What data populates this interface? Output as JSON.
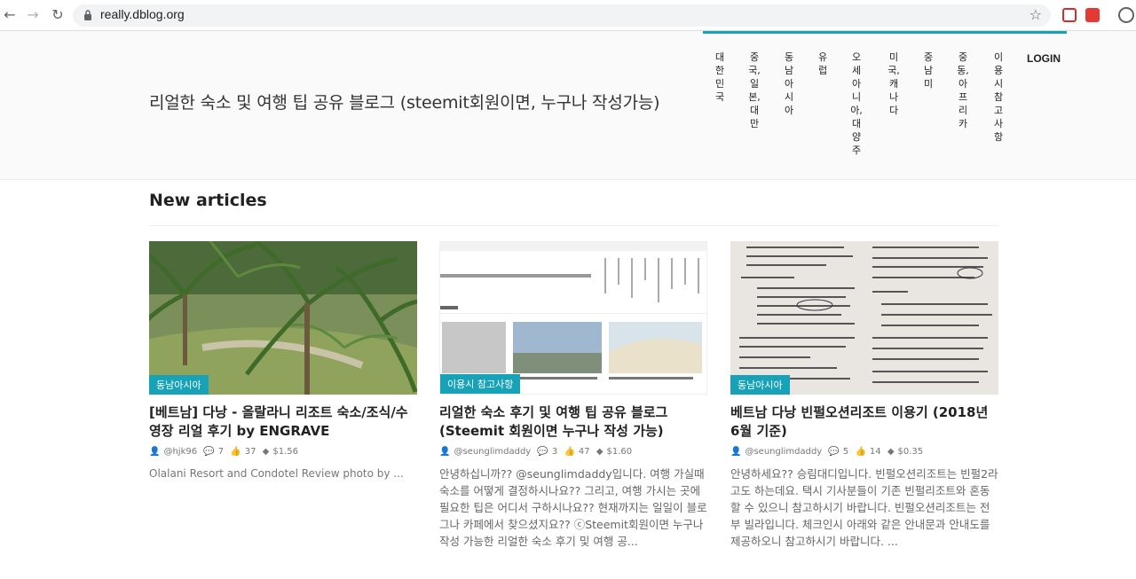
{
  "browser": {
    "url": "really.dblog.org"
  },
  "site": {
    "title": "리얼한 숙소 및 여행 팁 공유 블로그 (steemit회원이면, 누구나 작성가능)",
    "nav": [
      "대한민국",
      "중국,일본,대만",
      "동남아시아",
      "유럽",
      "오세아니아,대양주",
      "미국,캐나다",
      "중남미",
      "중동,아프리카",
      "이용시참고사항"
    ],
    "login": "LOGIN"
  },
  "section": {
    "title": "New articles"
  },
  "cards": [
    {
      "badge": "동남아시아",
      "title": "[베트남] 다낭 - 올랄라니 리조트 숙소/조식/수영장 리얼 후기 by ENGRAVE",
      "author": "@hjk96",
      "comments": "7",
      "votes": "37",
      "payout": "$1.56",
      "excerpt": "Olalani Resort and Condotel Review photo by ..."
    },
    {
      "badge": "이용시 참고사항",
      "title": "리얼한 숙소 후기 및 여행 팁 공유 블로그 (Steemit 회원이면 누구나 작성 가능)",
      "author": "@seunglimdaddy",
      "comments": "3",
      "votes": "47",
      "payout": "$1.60",
      "excerpt": "안녕하십니까?? @seunglimdaddy입니다. 여행 가실때 숙소를 어떻게 결정하시나요?? 그리고, 여행 가시는 곳에 필요한 팁은 어디서 구하시나요?? 현재까지는 일일이 블로그나 카페에서 찾으셨지요?? ⓒSteemit회원이면 누구나 작성 가능한 리얼한 숙소 후기 및 여행 공..."
    },
    {
      "badge": "동남아시아",
      "title": "베트남 다낭 빈펄오션리조트 이용기 (2018년 6월 기준)",
      "author": "@seunglimdaddy",
      "comments": "5",
      "votes": "14",
      "payout": "$0.35",
      "excerpt": "안녕하세요?? 승림대디입니다. 빈펄오션리조트는 빈펄2라고도 하는데요. 택시 기사분들이 기존 빈펄리조트와 혼동할 수 있으니 참고하시기 바랍니다. 빈펄오션리조트는 전부 빌라입니다. 체크인시 아래와 같은 안내문과 안내도를 제공하오니 참고하시기 바랍니다. ..."
    }
  ],
  "colors": {
    "accent": "#17a2b8"
  }
}
